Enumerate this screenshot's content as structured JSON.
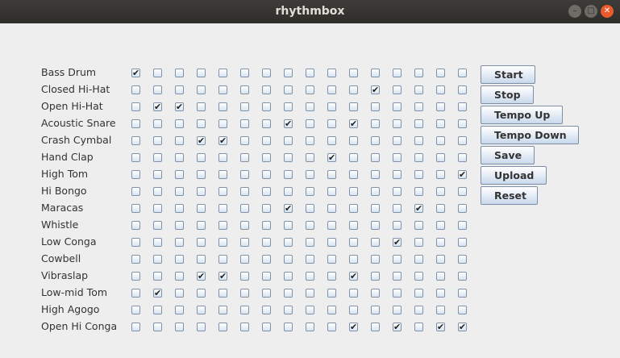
{
  "window": {
    "title": "rhythmbox"
  },
  "instruments": [
    {
      "name": "Bass Drum",
      "steps": [
        1,
        0,
        0,
        0,
        0,
        0,
        0,
        0,
        0,
        0,
        0,
        0,
        0,
        0,
        0,
        0
      ]
    },
    {
      "name": "Closed Hi-Hat",
      "steps": [
        0,
        0,
        0,
        0,
        0,
        0,
        0,
        0,
        0,
        0,
        0,
        1,
        0,
        0,
        0,
        0
      ]
    },
    {
      "name": "Open Hi-Hat",
      "steps": [
        0,
        1,
        1,
        0,
        0,
        0,
        0,
        0,
        0,
        0,
        0,
        0,
        0,
        0,
        0,
        0
      ]
    },
    {
      "name": "Acoustic Snare",
      "steps": [
        0,
        0,
        0,
        0,
        0,
        0,
        0,
        1,
        0,
        0,
        1,
        0,
        0,
        0,
        0,
        0
      ]
    },
    {
      "name": "Crash Cymbal",
      "steps": [
        0,
        0,
        0,
        1,
        1,
        0,
        0,
        0,
        0,
        0,
        0,
        0,
        0,
        0,
        0,
        0
      ]
    },
    {
      "name": "Hand Clap",
      "steps": [
        0,
        0,
        0,
        0,
        0,
        0,
        0,
        0,
        0,
        1,
        0,
        0,
        0,
        0,
        0,
        0
      ]
    },
    {
      "name": "High Tom",
      "steps": [
        0,
        0,
        0,
        0,
        0,
        0,
        0,
        0,
        0,
        0,
        0,
        0,
        0,
        0,
        0,
        1
      ]
    },
    {
      "name": "Hi Bongo",
      "steps": [
        0,
        0,
        0,
        0,
        0,
        0,
        0,
        0,
        0,
        0,
        0,
        0,
        0,
        0,
        0,
        0
      ]
    },
    {
      "name": "Maracas",
      "steps": [
        0,
        0,
        0,
        0,
        0,
        0,
        0,
        1,
        0,
        0,
        0,
        0,
        0,
        1,
        0,
        0
      ]
    },
    {
      "name": "Whistle",
      "steps": [
        0,
        0,
        0,
        0,
        0,
        0,
        0,
        0,
        0,
        0,
        0,
        0,
        0,
        0,
        0,
        0
      ]
    },
    {
      "name": "Low Conga",
      "steps": [
        0,
        0,
        0,
        0,
        0,
        0,
        0,
        0,
        0,
        0,
        0,
        0,
        1,
        0,
        0,
        0
      ]
    },
    {
      "name": "Cowbell",
      "steps": [
        0,
        0,
        0,
        0,
        0,
        0,
        0,
        0,
        0,
        0,
        0,
        0,
        0,
        0,
        0,
        0
      ]
    },
    {
      "name": "Vibraslap",
      "steps": [
        0,
        0,
        0,
        1,
        1,
        0,
        0,
        0,
        0,
        0,
        1,
        0,
        0,
        0,
        0,
        0
      ]
    },
    {
      "name": "Low-mid Tom",
      "steps": [
        0,
        1,
        0,
        0,
        0,
        0,
        0,
        0,
        0,
        0,
        0,
        0,
        0,
        0,
        0,
        0
      ]
    },
    {
      "name": "High Agogo",
      "steps": [
        0,
        0,
        0,
        0,
        0,
        0,
        0,
        0,
        0,
        0,
        0,
        0,
        0,
        0,
        0,
        0
      ]
    },
    {
      "name": "Open Hi Conga",
      "steps": [
        0,
        0,
        0,
        0,
        0,
        0,
        0,
        0,
        0,
        0,
        1,
        0,
        1,
        0,
        1,
        1
      ]
    }
  ],
  "buttons": [
    {
      "id": "start",
      "label": "Start"
    },
    {
      "id": "stop",
      "label": "Stop"
    },
    {
      "id": "tempo-up",
      "label": "Tempo Up"
    },
    {
      "id": "tempo-down",
      "label": "Tempo Down"
    },
    {
      "id": "save",
      "label": "Save"
    },
    {
      "id": "upload",
      "label": "Upload"
    },
    {
      "id": "reset",
      "label": "Reset"
    }
  ]
}
